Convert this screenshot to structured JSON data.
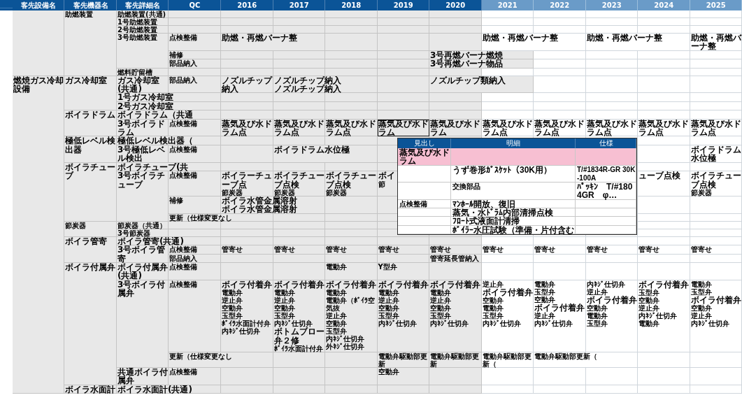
{
  "columns": [
    "客先設備名",
    "客先機器名",
    "客先詳細名",
    "QC"
  ],
  "years": [
    {
      "label": "2016",
      "projected": false
    },
    {
      "label": "2017",
      "projected": false
    },
    {
      "label": "2018",
      "projected": false
    },
    {
      "label": "2019",
      "projected": false
    },
    {
      "label": "2020",
      "projected": false
    },
    {
      "label": "2021",
      "projected": true
    },
    {
      "label": "2022",
      "projected": true
    },
    {
      "label": "2023",
      "projected": true
    },
    {
      "label": "2024",
      "projected": true
    },
    {
      "label": "2025",
      "projected": true
    }
  ],
  "groups": [
    {
      "devices": [
        {
          "name": "助燃装置",
          "details": [
            {
              "name": "助燃装置(共通)"
            },
            {
              "name": "1号助燃装置"
            },
            {
              "name": "2号助燃装置"
            },
            {
              "name": "3号助燃装置",
              "items": [
                {
                  "qc": "点検整備",
                  "cells": [
                    [
                      "助燃・再燃バーナ整"
                    ],
                    [],
                    [],
                    [],
                    [],
                    [
                      "助燃・再燃バーナ整"
                    ],
                    [],
                    [
                      "助燃・再燃バーナ整"
                    ],
                    [],
                    [
                      "助燃・再燃バーナ整"
                    ]
                  ]
                },
                {
                  "qc": "補修",
                  "cells": [
                    [],
                    [],
                    [],
                    [],
                    [
                      "3号再燃バーナ燃焼"
                    ],
                    [],
                    [],
                    [],
                    [],
                    []
                  ]
                },
                {
                  "qc": "部品納入",
                  "cells": [
                    [],
                    [],
                    [],
                    [],
                    [
                      "3号再燃バーナ物品"
                    ],
                    [],
                    [],
                    [],
                    [],
                    []
                  ]
                }
              ]
            },
            {
              "name": "燃料貯留槽"
            }
          ]
        }
      ]
    },
    {
      "equipment": "燃焼ガス冷却設備",
      "devices": [
        {
          "name": "ガス冷却室",
          "details": [
            {
              "name": "ガス冷却室(共通)",
              "items": [
                {
                  "qc": "部品納入",
                  "cells": [
                    [
                      "ノズルチップ納入"
                    ],
                    [
                      "ノズルチップ納入",
                      "ノズルチップ納入"
                    ],
                    [],
                    [],
                    [
                      "ノズルチップ類納入"
                    ],
                    [],
                    [],
                    [],
                    [],
                    []
                  ]
                }
              ]
            },
            {
              "name": "1号ガス冷却室"
            },
            {
              "name": "2号ガス冷却室"
            }
          ]
        },
        {
          "name": "ボイラドラム",
          "details": [
            {
              "name": "ボイラドラム（共通"
            },
            {
              "name": "3号ボイラドラム",
              "items": [
                {
                  "qc": "点検整備",
                  "cells": [
                    [
                      "蒸気及び水ドラム点"
                    ],
                    [
                      "蒸気及び水ドラム点"
                    ],
                    [
                      "蒸気及び水ドラム点"
                    ],
                    {
                      "lines": [
                        "蒸気及び水ドラム"
                      ],
                      "selected": true
                    },
                    [
                      "蒸気及び水ドラム"
                    ],
                    [
                      "蒸気及び水ドラム点"
                    ],
                    [
                      "蒸気及び水ドラム点"
                    ],
                    [
                      "蒸気及び水ドラム点"
                    ],
                    [
                      "蒸気及び水ドラム点"
                    ],
                    [
                      "蒸気及び水ドラム点"
                    ]
                  ]
                }
              ]
            }
          ]
        },
        {
          "name": "極低レベル検出器",
          "details": [
            {
              "name": "極低レベル検出器（"
            },
            {
              "name": "3号極低レベル検出",
              "items": [
                {
                  "qc": "点検整備",
                  "cells": [
                    [],
                    [
                      "ボイラドラム水位極"
                    ],
                    [],
                    [],
                    [],
                    [],
                    [],
                    [],
                    [],
                    [
                      "ボイラドラム水位極"
                    ]
                  ]
                }
              ]
            }
          ]
        },
        {
          "name": "ボイラチューブ",
          "details": [
            {
              "name": "ボイラチューブ(共"
            },
            {
              "name": "3号ボイラチューブ",
              "items": [
                {
                  "qc": "点検整備",
                  "cells": [
                    [
                      "ボイラーチューブ点",
                      "節炭器"
                    ],
                    [
                      "ボイラチューブ点検",
                      "節炭器"
                    ],
                    [
                      "ボイラチューブ点検",
                      "節炭器"
                    ],
                    [
                      "ボイ",
                      "節"
                    ],
                    [],
                    [],
                    [],
                    [],
                    [
                      "ューブ点検"
                    ],
                    [
                      "ボイラチューブ点検",
                      "節炭器"
                    ]
                  ]
                },
                {
                  "qc": "補修",
                  "cells": [
                    [
                      "ボイラ水管金属溶射",
                      "ボイラ水管金属溶射"
                    ],
                    [],
                    [],
                    [],
                    [],
                    [],
                    [],
                    [],
                    [],
                    []
                  ]
                },
                {
                  "qc": "更新（仕様変更なし"
                }
              ]
            }
          ]
        },
        {
          "name": "節炭器",
          "details": [
            {
              "name": "節炭器（共通）"
            },
            {
              "name": "3号節炭器"
            }
          ]
        },
        {
          "name": "ボイラ管寄",
          "details": [
            {
              "name": "ボイラ管寄(共通)"
            },
            {
              "name": "3号ボイラ管寄",
              "items": [
                {
                  "qc": "点検整備",
                  "cells": [
                    [
                      "管寄せ"
                    ],
                    [
                      "管寄せ"
                    ],
                    [
                      "管寄せ"
                    ],
                    [
                      "管寄せ"
                    ],
                    [
                      "管寄せ"
                    ],
                    [
                      "管寄せ"
                    ],
                    [
                      "管寄せ"
                    ],
                    [
                      "管寄せ"
                    ],
                    [
                      "管寄せ"
                    ],
                    [
                      "管寄せ"
                    ]
                  ]
                },
                {
                  "qc": "部品納入",
                  "cells": [
                    [],
                    [],
                    [],
                    [],
                    [
                      "管寄延長管納入"
                    ],
                    [],
                    [],
                    [],
                    [],
                    []
                  ]
                }
              ]
            }
          ]
        },
        {
          "name": "ボイラ付属弁",
          "details": [
            {
              "name": "ボイラ付属弁(共通)",
              "items": [
                {
                  "qc": "点検整備",
                  "cells": [
                    [],
                    [],
                    [
                      "電動弁"
                    ],
                    [
                      "Y型弁"
                    ],
                    [],
                    [],
                    [],
                    [],
                    [],
                    []
                  ]
                }
              ]
            },
            {
              "name": "3号ボイラ付属弁",
              "items": [
                {
                  "qc": "点検整備",
                  "cells": [
                    [
                      "ボイラ付着弁",
                      "電動弁",
                      "逆止弁",
                      "空動弁",
                      "玉型弁",
                      "ﾎﾞｲﾗ水面計付弁",
                      "内ﾈｼﾞ仕切弁"
                    ],
                    [
                      "ボイラ付着弁",
                      "電動弁",
                      "逆止弁",
                      "空動弁",
                      "玉型弁",
                      "内ﾈｼﾞ仕切弁",
                      "ボトムブロー弁２修",
                      "ﾎﾞｲﾗ水面計付弁"
                    ],
                    [
                      "ボイラ付着弁",
                      "電動弁",
                      "電動弁（ﾎﾞｲﾗ空気抜",
                      "逆止弁",
                      "空動弁",
                      "玉型弁",
                      "内ﾈｼﾞ仕切弁",
                      "外ﾈｼﾞ仕切弁"
                    ],
                    [
                      "ボイラ付着弁",
                      "電動弁",
                      "逆止弁",
                      "空動弁",
                      "玉型弁",
                      "内ﾈｼﾞ仕切弁"
                    ],
                    [
                      "ボイラ付着弁",
                      "電動弁",
                      "逆止弁",
                      "空動弁",
                      "玉型弁",
                      "内ﾈｼﾞ仕切弁"
                    ],
                    [
                      "逆止弁",
                      "ボイラ付着弁",
                      "空動弁",
                      "電動弁",
                      "玉型弁",
                      "内ﾈｼﾞ仕切弁"
                    ],
                    [
                      "電動弁",
                      "玉型弁",
                      "空動弁",
                      "ボイラ付着弁",
                      "逆止弁",
                      "内ﾈｼﾞ仕切弁"
                    ],
                    [
                      "内ﾈｼﾞ仕切弁",
                      "逆止弁",
                      "ボイラ付着弁",
                      "空動弁",
                      "電動弁",
                      "玉型弁"
                    ],
                    [
                      "ボイラ付着弁",
                      "玉型弁",
                      "空動弁",
                      "逆止弁",
                      "内ﾈｼﾞ仕切弁",
                      "電動弁"
                    ],
                    [
                      "電動弁",
                      "玉型弁",
                      "ボイラ付着弁",
                      "空動弁",
                      "逆止弁",
                      "内ﾈｼﾞ仕切弁"
                    ]
                  ]
                },
                {
                  "qc": "更新（仕様変更なし",
                  "cells": [
                    [],
                    [],
                    [],
                    [
                      "電動弁駆動部更新"
                    ],
                    [
                      "電動弁駆動部更新"
                    ],
                    [
                      "電動弁駆動部更新（"
                    ],
                    [
                      "電動弁駆動部更新（"
                    ],
                    [],
                    [],
                    []
                  ]
                }
              ]
            },
            {
              "name": "共通ボイラ付属弁",
              "items": [
                {
                  "qc": "点検整備",
                  "cells": [
                    [],
                    [],
                    [],
                    [
                      "空動弁"
                    ],
                    [],
                    [],
                    [],
                    [],
                    [],
                    []
                  ]
                }
              ]
            }
          ]
        },
        {
          "name": "ボイラ水面計",
          "details": [
            {
              "name": "ボイラ水面計(共通)"
            }
          ]
        }
      ]
    }
  ],
  "popup": {
    "columns": [
      "見出し",
      "明細",
      "仕様"
    ],
    "rows": [
      {
        "kind": "section",
        "heading": "蒸気及び水ドラム"
      },
      {
        "kind": "item",
        "detail": "うず巻形ｶﾞｽｹｯﾄ（30K用）",
        "spec": "T/#1834R-GR 30K-100A"
      },
      {
        "kind": "item",
        "detail": "交換部品",
        "spec": "ﾊﾟｯｷﾝ　T/#1804GR　φ…"
      },
      {
        "kind": "item",
        "heading": "点検整備",
        "detail": "ﾏﾝﾎｰﾙ開放、復旧"
      },
      {
        "kind": "item",
        "detail": "蒸気・水ﾄﾞﾗﾑ内部清掃点検"
      },
      {
        "kind": "item",
        "detail": "ﾌﾛｰﾄ式液面計清掃"
      },
      {
        "kind": "item",
        "detail": "ﾎﾞｲﾗｰ水圧試験（準備・片付含む"
      }
    ]
  }
}
